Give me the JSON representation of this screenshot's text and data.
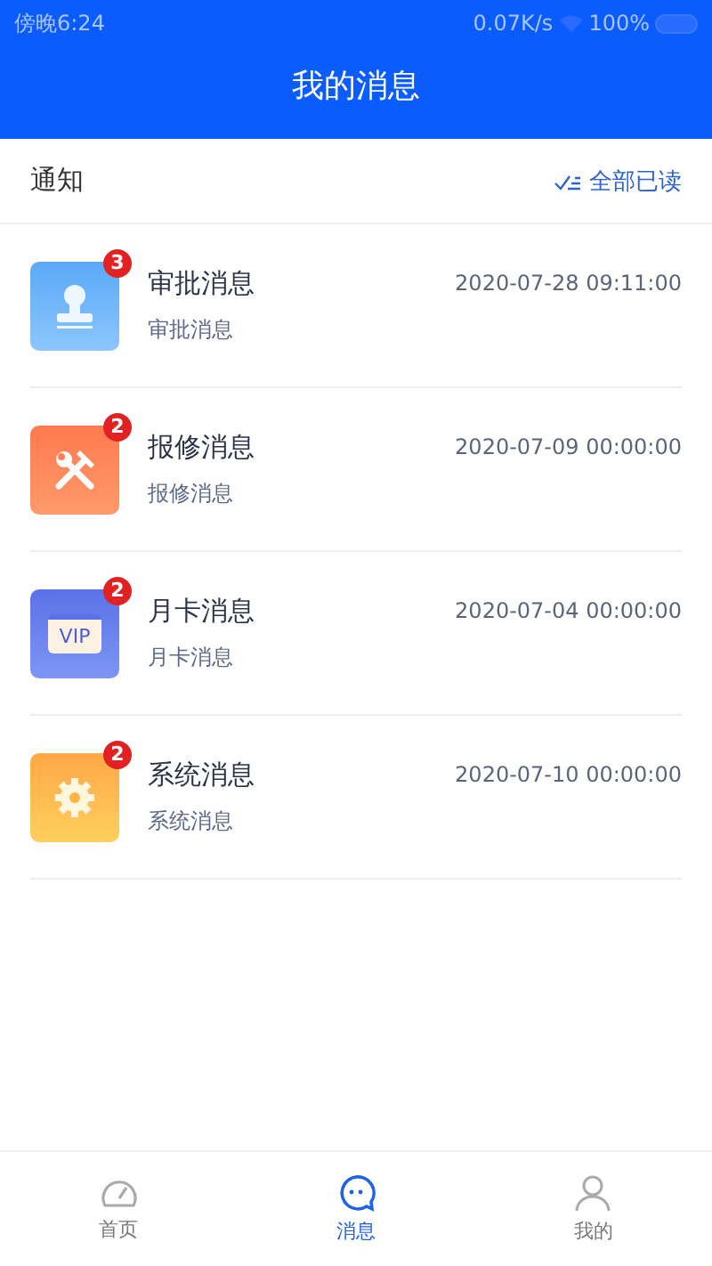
{
  "status_bar": {
    "time": "傍晚6:24",
    "speed": "0.07K/s",
    "battery": "100%"
  },
  "header": {
    "title": "我的消息"
  },
  "section": {
    "title": "通知",
    "action": "全部已读"
  },
  "messages": [
    {
      "kind": "stamp",
      "title": "审批消息",
      "subtitle": "审批消息",
      "time": "2020-07-28 09:11:00",
      "badge": "3"
    },
    {
      "kind": "tools",
      "title": "报修消息",
      "subtitle": "报修消息",
      "time": "2020-07-09 00:00:00",
      "badge": "2"
    },
    {
      "kind": "card",
      "icon_label": "VIP",
      "title": "月卡消息",
      "subtitle": "月卡消息",
      "time": "2020-07-04 00:00:00",
      "badge": "2"
    },
    {
      "kind": "gear",
      "title": "系统消息",
      "subtitle": "系统消息",
      "time": "2020-07-10 00:00:00",
      "badge": "2"
    }
  ],
  "tabbar": [
    {
      "kind": "home",
      "label": "首页",
      "selected": false
    },
    {
      "kind": "chat",
      "label": "消息",
      "selected": true
    },
    {
      "kind": "user",
      "label": "我的",
      "selected": false
    }
  ]
}
